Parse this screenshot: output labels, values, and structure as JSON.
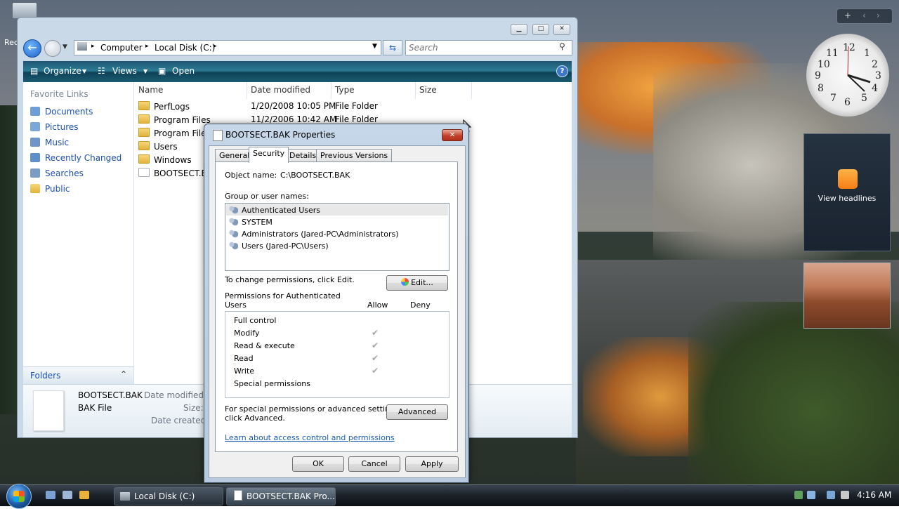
{
  "explorer": {
    "breadcrumb": [
      "Computer",
      "Local Disk (C:)"
    ],
    "search_placeholder": "Search",
    "toolbar": {
      "organize": "Organize",
      "views": "Views",
      "open": "Open"
    },
    "favorite_links_header": "Favorite Links",
    "favorite_links": [
      "Documents",
      "Pictures",
      "Music",
      "Recently Changed",
      "Searches",
      "Public"
    ],
    "folders_label": "Folders",
    "columns": [
      "Name",
      "Date modified",
      "Type",
      "Size"
    ],
    "files": [
      {
        "name": "PerfLogs",
        "date": "1/20/2008 10:05 PM",
        "type": "File Folder"
      },
      {
        "name": "Program Files",
        "date": "11/2/2006 10:42 AM",
        "type": "File Folder"
      },
      {
        "name": "Program Files",
        "date": "",
        "type": ""
      },
      {
        "name": "Users",
        "date": "",
        "type": ""
      },
      {
        "name": "Windows",
        "date": "",
        "type": ""
      },
      {
        "name": "BOOTSECT.BAK",
        "date": "",
        "type": ""
      }
    ],
    "details": {
      "name": "BOOTSECT.BAK",
      "type": "BAK File",
      "date_modified_label": "Date modified:",
      "size_label": "Size:",
      "date_created_label": "Date created:"
    }
  },
  "dialog": {
    "title": "BOOTSECT.BAK Properties",
    "tabs": [
      "General",
      "Security",
      "Details",
      "Previous Versions"
    ],
    "object_name_label": "Object name:",
    "object_name_value": "C:\\BOOTSECT.BAK",
    "group_label": "Group or user names:",
    "users": [
      "Authenticated Users",
      "SYSTEM",
      "Administrators (Jared-PC\\Administrators)",
      "Users (Jared-PC\\Users)"
    ],
    "change_text": "To change permissions, click Edit.",
    "edit_button": "Edit...",
    "perm_header_line1": "Permissions for Authenticated",
    "perm_header_line2": "Users",
    "allow_label": "Allow",
    "deny_label": "Deny",
    "permissions": [
      {
        "name": "Full control",
        "allow": false
      },
      {
        "name": "Modify",
        "allow": true
      },
      {
        "name": "Read & execute",
        "allow": true
      },
      {
        "name": "Read",
        "allow": true
      },
      {
        "name": "Write",
        "allow": true
      },
      {
        "name": "Special permissions",
        "allow": false
      }
    ],
    "special_line1": "For special permissions or advanced settings,",
    "special_line2": "click Advanced.",
    "advanced_button": "Advanced",
    "learn_link": "Learn about access control and permissions",
    "ok_button": "OK",
    "cancel_button": "Cancel",
    "apply_button": "Apply"
  },
  "gadgets": {
    "rss_label": "View headlines"
  },
  "taskbar": {
    "buttons": [
      "Local Disk (C:)",
      "BOOTSECT.BAK Pro..."
    ],
    "clock": "4:16 AM"
  },
  "desktop": {
    "recycle_label": "Rec"
  }
}
